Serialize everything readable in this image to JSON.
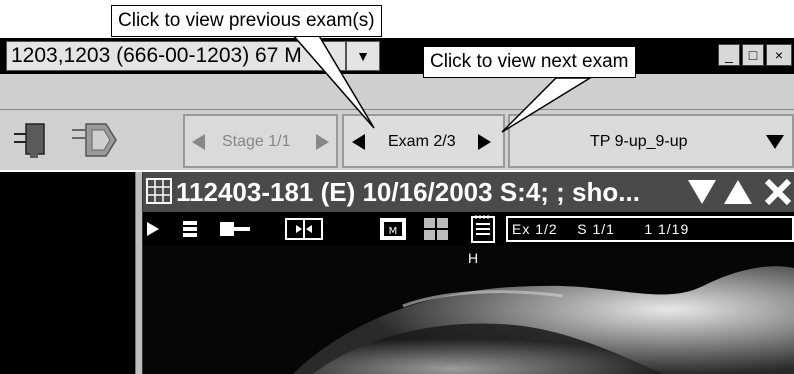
{
  "callouts": {
    "previous": "Click to view previous exam(s)",
    "next": "Click to view next exam"
  },
  "window": {
    "patient_text": "1203,1203 (666-00-1203) 67 M",
    "dropdown_glyph": "▼",
    "minimize_glyph": "_",
    "maximize_glyph": "□",
    "close_glyph": "×"
  },
  "navigation": {
    "stage_label": "Stage 1/1",
    "exam_label": "Exam 2/3",
    "protocol_label": "TP 9-up_9-up"
  },
  "viewer": {
    "title": "112403-181 (E) 10/16/2003 S:4; ; sho...",
    "info_exam": "Ex 1/2",
    "info_series": "S 1/1",
    "info_image": "1 1/19",
    "orientation_marker": "H"
  },
  "colors": {
    "accent_toolbar": "#cfcfcf",
    "viewer_header": "#4a4a4a",
    "background": "#ffffff"
  },
  "icons": [
    "toolbar-tool-icon",
    "toolbar-arrow-icon",
    "grid-icon",
    "down-arrow-icon",
    "up-arrow-icon",
    "close-icon",
    "play-icon",
    "stack-icon",
    "link-icon",
    "split-icon",
    "single-view-icon",
    "quad-view-icon",
    "notes-icon"
  ]
}
